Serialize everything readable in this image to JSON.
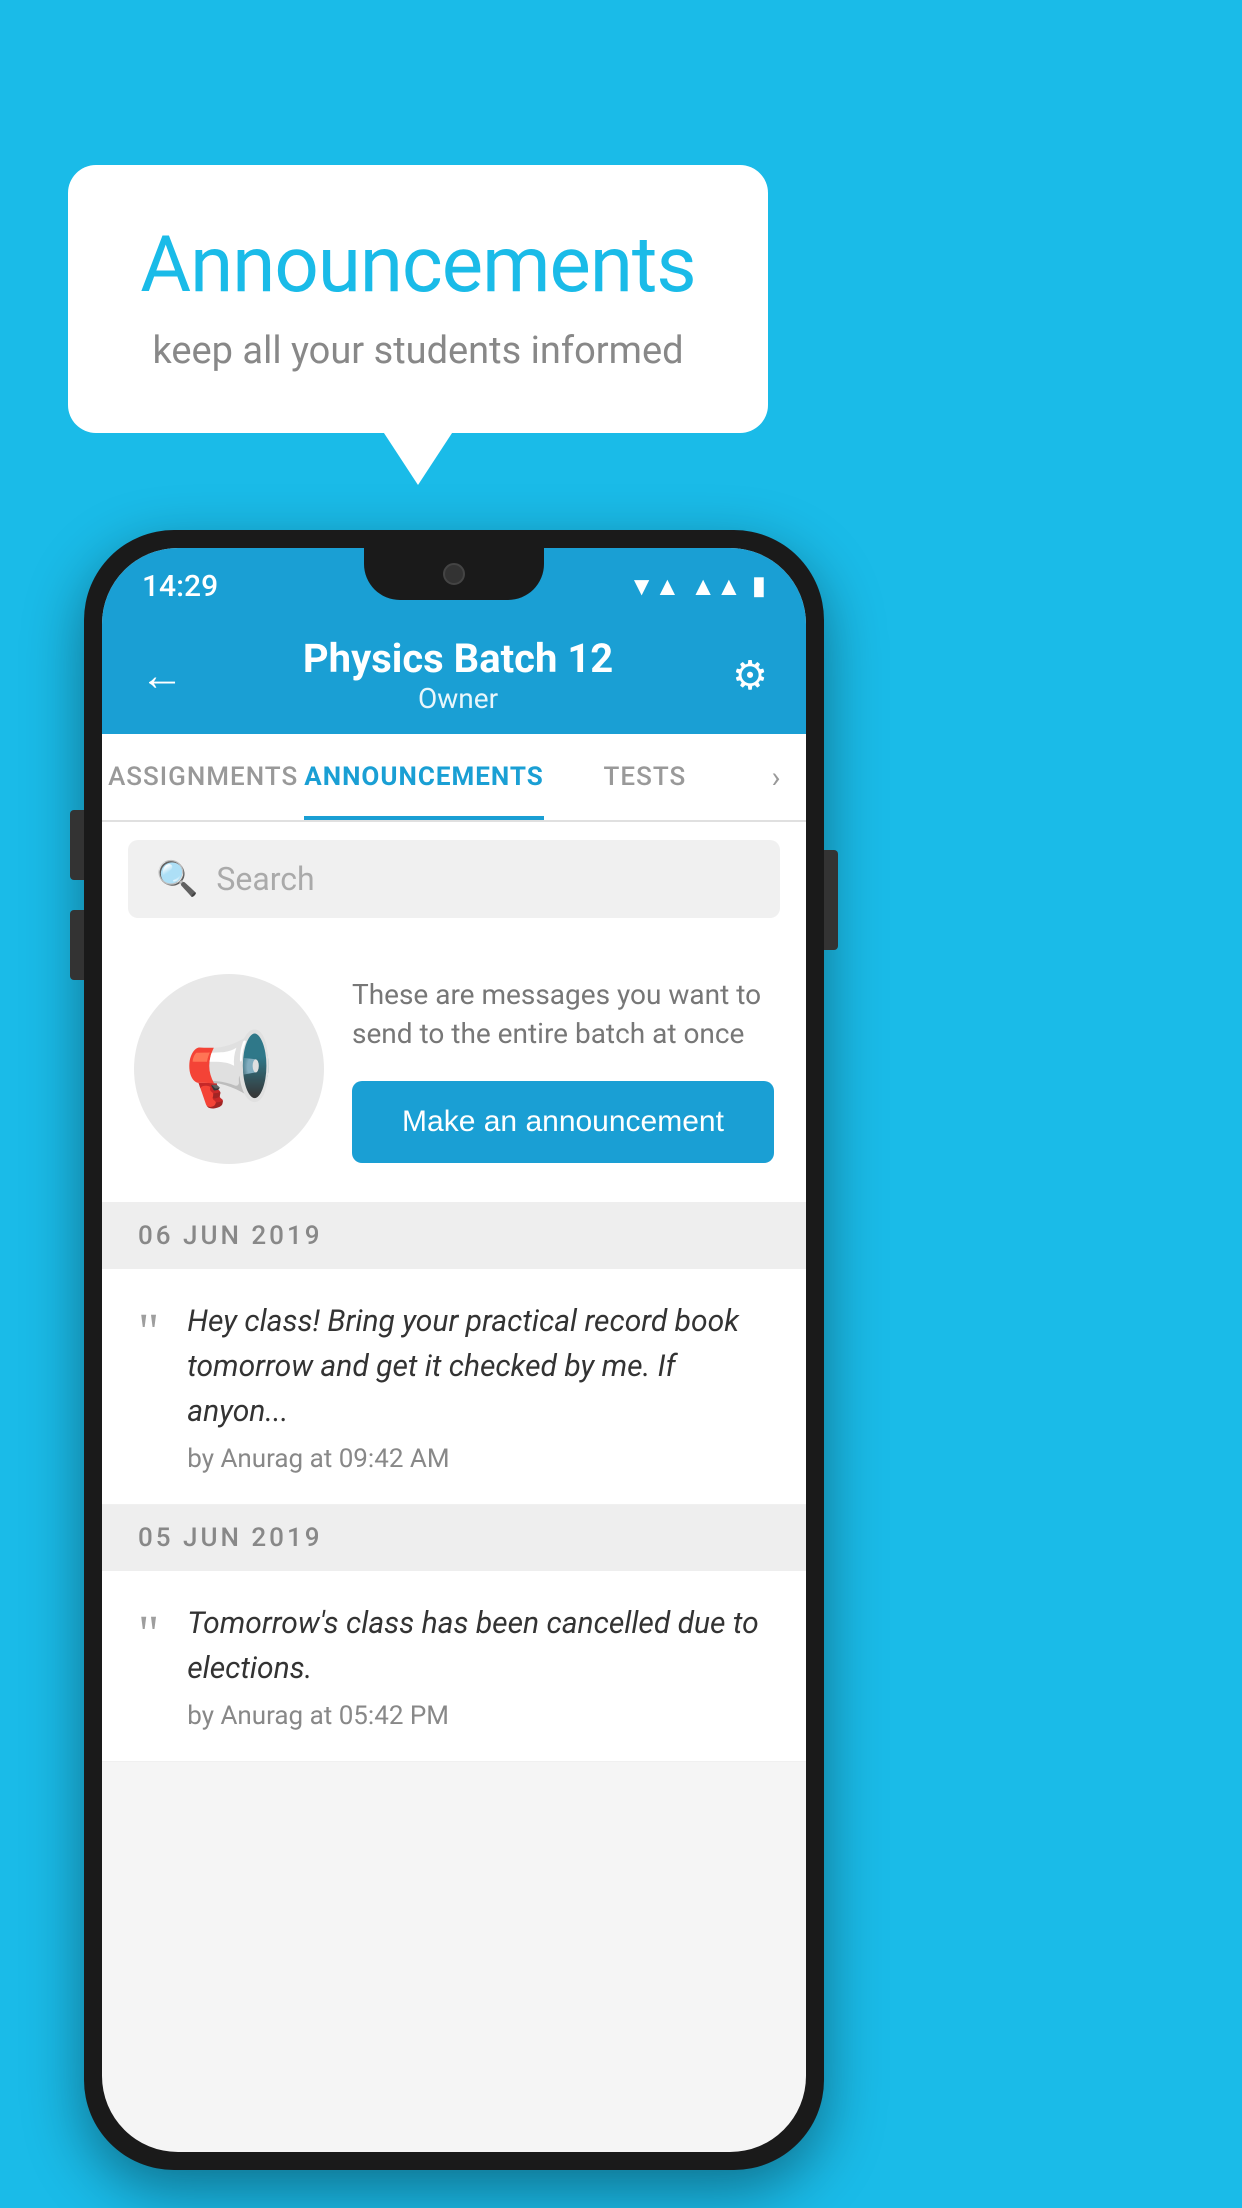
{
  "background": {
    "color": "#1ABBE8"
  },
  "speech_bubble": {
    "title": "Announcements",
    "subtitle": "keep all your students informed"
  },
  "phone": {
    "status_bar": {
      "time": "14:29",
      "icons": [
        "wifi",
        "signal",
        "battery"
      ]
    },
    "header": {
      "title": "Physics Batch 12",
      "subtitle": "Owner",
      "back_label": "←",
      "settings_label": "⚙"
    },
    "tabs": [
      {
        "label": "ASSIGNMENTS",
        "active": false
      },
      {
        "label": "ANNOUNCEMENTS",
        "active": true
      },
      {
        "label": "TESTS",
        "active": false
      }
    ],
    "search": {
      "placeholder": "Search"
    },
    "promo": {
      "description": "These are messages you want to send to the entire batch at once",
      "button_label": "Make an announcement"
    },
    "announcements": [
      {
        "date": "06  JUN  2019",
        "text": "Hey class! Bring your practical record book tomorrow and get it checked by me. If anyon...",
        "meta": "by Anurag at 09:42 AM"
      },
      {
        "date": "05  JUN  2019",
        "text": "Tomorrow's class has been cancelled due to elections.",
        "meta": "by Anurag at 05:42 PM"
      }
    ]
  }
}
